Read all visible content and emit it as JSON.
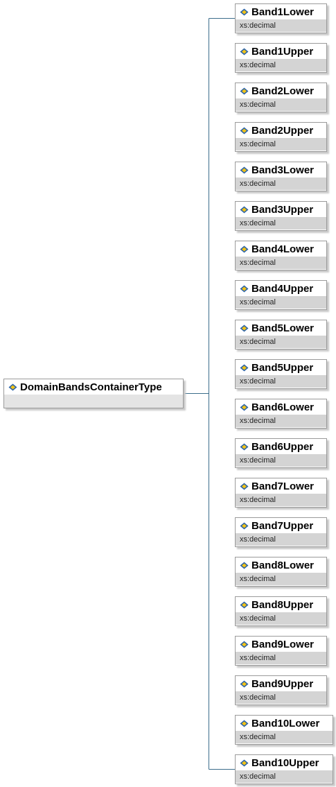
{
  "root": {
    "name": "DomainBandsContainerType",
    "icon": "element-type-icon"
  },
  "connector_color": "#3a6c8a",
  "children": [
    {
      "name": "Band1Lower",
      "type": "xs:decimal"
    },
    {
      "name": "Band1Upper",
      "type": "xs:decimal"
    },
    {
      "name": "Band2Lower",
      "type": "xs:decimal"
    },
    {
      "name": "Band2Upper",
      "type": "xs:decimal"
    },
    {
      "name": "Band3Lower",
      "type": "xs:decimal"
    },
    {
      "name": "Band3Upper",
      "type": "xs:decimal"
    },
    {
      "name": "Band4Lower",
      "type": "xs:decimal"
    },
    {
      "name": "Band4Upper",
      "type": "xs:decimal"
    },
    {
      "name": "Band5Lower",
      "type": "xs:decimal"
    },
    {
      "name": "Band5Upper",
      "type": "xs:decimal"
    },
    {
      "name": "Band6Lower",
      "type": "xs:decimal"
    },
    {
      "name": "Band6Upper",
      "type": "xs:decimal"
    },
    {
      "name": "Band7Lower",
      "type": "xs:decimal"
    },
    {
      "name": "Band7Upper",
      "type": "xs:decimal"
    },
    {
      "name": "Band8Lower",
      "type": "xs:decimal"
    },
    {
      "name": "Band8Upper",
      "type": "xs:decimal"
    },
    {
      "name": "Band9Lower",
      "type": "xs:decimal"
    },
    {
      "name": "Band9Upper",
      "type": "xs:decimal"
    },
    {
      "name": "Band10Lower",
      "type": "xs:decimal"
    },
    {
      "name": "Band10Upper",
      "type": "xs:decimal"
    }
  ]
}
